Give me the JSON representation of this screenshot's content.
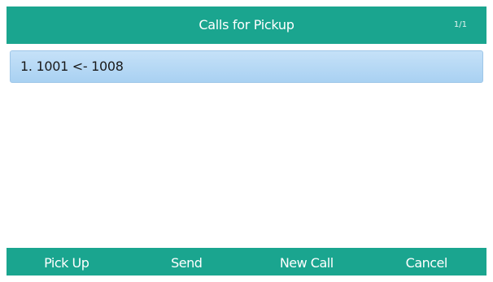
{
  "header": {
    "title": "Calls for Pickup",
    "page_indicator": "1/1"
  },
  "calls": [
    {
      "label": "1. 1001 <- 1008"
    }
  ],
  "softkeys": [
    {
      "label": "Pick Up"
    },
    {
      "label": "Send"
    },
    {
      "label": "New Call"
    },
    {
      "label": "Cancel"
    }
  ],
  "colors": {
    "title_bar": "#1aa58f",
    "softkey_bar": "#1aa58f",
    "selected_item": "#b4d8f4"
  }
}
